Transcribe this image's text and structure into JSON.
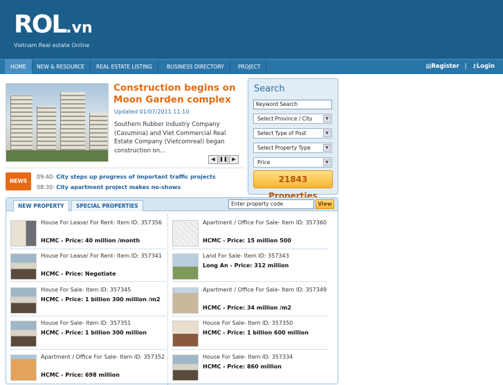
{
  "header": {
    "logo_text": "ROL",
    "logo_suffix": ".vn",
    "tagline": "Vietnam Real estate Online"
  },
  "nav": {
    "items": [
      "HOME",
      "NEW & RESOURCE",
      "REAL ESTATE LISTING",
      "BUSINESS DIRECTORY",
      "PROJECT"
    ],
    "register": "Register",
    "separator": "|",
    "login": "Login"
  },
  "featured": {
    "title": "Construction begins on Moon Garden complex",
    "date": "Updated 01/07/2011 11:10",
    "body": "Southern Rubber Industry Company (Casumina) and Viet Commercial Real Estate Company (Vietcomreal) began construction on...",
    "pager": [
      "◀",
      "❚❚",
      "▶"
    ]
  },
  "news": {
    "badge": "NEWS",
    "items": [
      {
        "time": "09:40:",
        "headline": "City steps up progress of important traffic projects"
      },
      {
        "time": "08:30:",
        "headline": "City apartment project makes no-shows"
      }
    ]
  },
  "search": {
    "title": "Search",
    "keyword_value": "Keyword Search",
    "selects": [
      "Select Province / City",
      "Select Type of Post",
      "Select Property Type",
      "Price"
    ],
    "count_label": "21843 Properties"
  },
  "property_panel": {
    "tabs": [
      "NEW PROPERTY",
      "SPECIAL PROPERTIES"
    ],
    "code_input_value": "Enter property code",
    "view_button": "View",
    "left_items": [
      {
        "title": "House For Lease/ For Rent- Item ID: 357356",
        "price": "HCMC - Price: 40 million /month",
        "thumb": "room-photo"
      },
      {
        "title": "House For Lease/ For Rent- Item ID: 357341",
        "price": "HCMC - Price: Negotiate",
        "thumb": "house-photo"
      },
      {
        "title": "House For Sale- Item ID: 357345",
        "price": "HCMC - Price: 1 billion 300 million /m2",
        "thumb": "house-photo"
      },
      {
        "title": "House For Sale- Item ID: 357351",
        "price": "HCMC - Price: 1 billion 300 million",
        "thumb": "house-photo"
      },
      {
        "title": "Apartment / Office For Sale- Item ID: 357352",
        "price": "HCMC - Price: 698 million",
        "thumb": "tower-photo"
      }
    ],
    "right_items": [
      {
        "title": "Apartment / Office For Sale- Item ID: 357360",
        "price": "HCMC - Price: 15 million 500",
        "thumb": "map-image"
      },
      {
        "title": "Land For Sale- Item ID: 357343",
        "price": "Long An - Price: 312 million",
        "thumb": "land-photo"
      },
      {
        "title": "Apartment / Office For Sale- Item ID: 357349",
        "price": "HCMC - Price: 34 million /m2",
        "thumb": "apartment-photo"
      },
      {
        "title": "House For Sale- Item ID: 357350",
        "price": "HCMC - Price: 1 billion 600 million",
        "thumb": "shop-photo"
      },
      {
        "title": "House For Sale- Item ID: 357334",
        "price": "HCMC - Price: 860 million",
        "thumb": "house-photo"
      }
    ]
  },
  "colors": {
    "header_bg": "#1b5e8a",
    "nav_bg": "#2a75a8",
    "accent_orange": "#e46b12",
    "link_blue": "#1f5f9a"
  }
}
